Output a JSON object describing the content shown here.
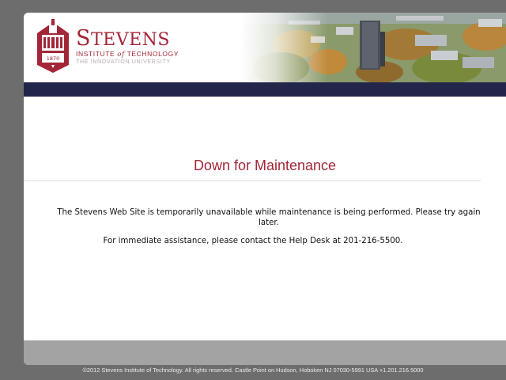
{
  "header": {
    "logo": {
      "wordmark_main_initial": "S",
      "wordmark_main_rest": "TEVENS",
      "wordmark_sub_before": "INSTITUTE",
      "wordmark_sub_of": "of",
      "wordmark_sub_after": "TECHNOLOGY",
      "tagline": "THE INNOVATION UNIVERSITY",
      "crest_year": "1870"
    },
    "photo": "campus-aerial-photo"
  },
  "main": {
    "title": "Down for Maintenance",
    "message": "The Stevens Web Site is temporarily unavailable while maintenance is being performed. Please try again later.",
    "contact": "For immediate assistance, please contact the Help Desk at 201-216-5500."
  },
  "footer": {
    "copyright": "©2012 Stevens Institute of Technology. All rights reserved. Castle Point on Hudson, Hoboken NJ 07030-5991 USA +1.201.216.5000"
  },
  "colors": {
    "brand_red": "#a32638",
    "navy_bar": "#22264b",
    "page_bg": "#6d6d6d",
    "footer_bar": "#a3a3a3"
  }
}
